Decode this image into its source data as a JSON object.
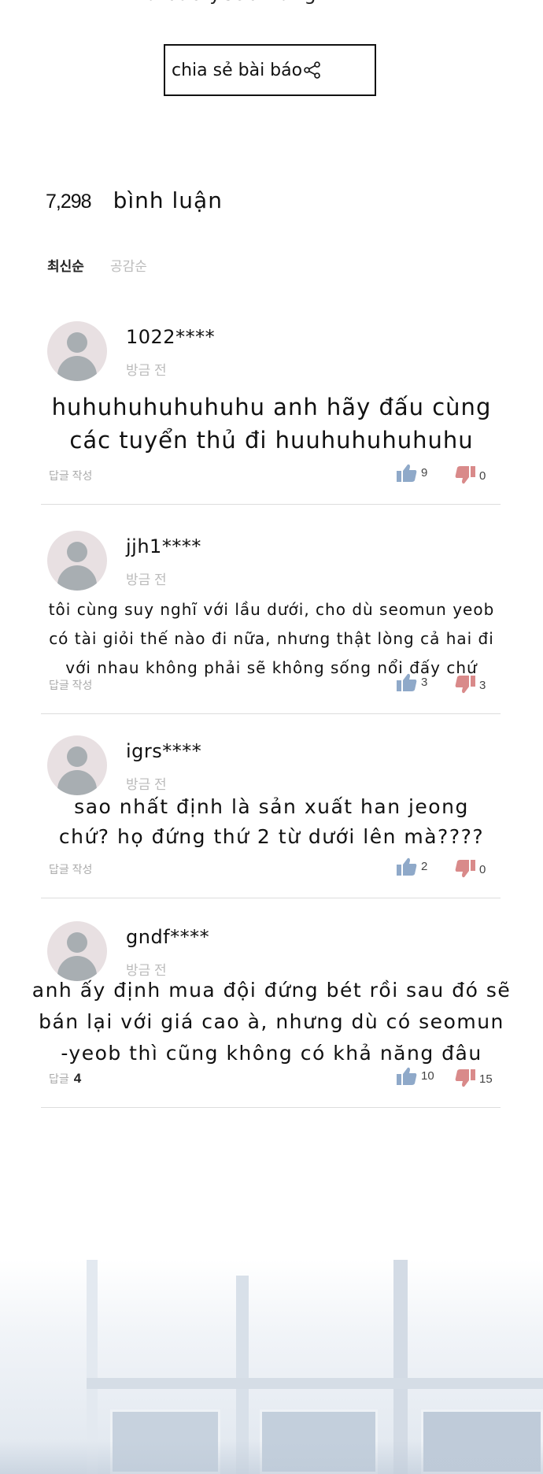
{
  "header": {
    "cut_title": "Như bao yeob hùng hi"
  },
  "share": {
    "label": "chia sẻ bài báo"
  },
  "summary": {
    "count": "7,298",
    "label": "bình luận"
  },
  "sort": {
    "latest": "최신순",
    "likes": "공감순"
  },
  "comments": [
    {
      "user": "1022****",
      "time": "방금 전",
      "text": "huhuhuhuhuhuhu anh hãy đấu cùng\ncác tuyển thủ đi huuhuhuhuhuhu",
      "reply": "답글 작성",
      "reply_count": "",
      "likes": "9",
      "dislikes": "0"
    },
    {
      "user": "jjh1****",
      "time": "방금 전",
      "text": "tôi cùng suy nghĩ với lầu dưới, cho dù seomun yeob\ncó tài giỏi thế nào đi nữa, nhưng thật lòng cả hai đi\nvới nhau không phải sẽ không sống nổi đấy chứ",
      "reply": "답글 작성",
      "reply_count": "",
      "likes": "3",
      "dislikes": "3"
    },
    {
      "user": "igrs****",
      "time": "방금 전",
      "text": "sao nhất định là sản xuất han jeong\nchứ? họ đứng thứ 2 từ dưới lên mà????",
      "reply": "답글 작성",
      "reply_count": "",
      "likes": "2",
      "dislikes": "0"
    },
    {
      "user": "gndf****",
      "time": "방금 전",
      "text": "anh ấy định mua đội đứng bét rồi sau đó sẽ\nbán lại với giá cao à, nhưng dù có seomun\n-yeob thì cũng không có khả năng đâu",
      "reply": "답글",
      "reply_count": "4",
      "likes": "10",
      "dislikes": "15"
    }
  ],
  "icons": {
    "share": "share-icon",
    "like": "thumbs-up-icon",
    "dislike": "thumbs-down-icon",
    "avatar": "user-avatar-icon"
  },
  "colors": {
    "like": "#8fa9c9",
    "dislike": "#d98a8a",
    "muted": "#bbbbbb"
  }
}
